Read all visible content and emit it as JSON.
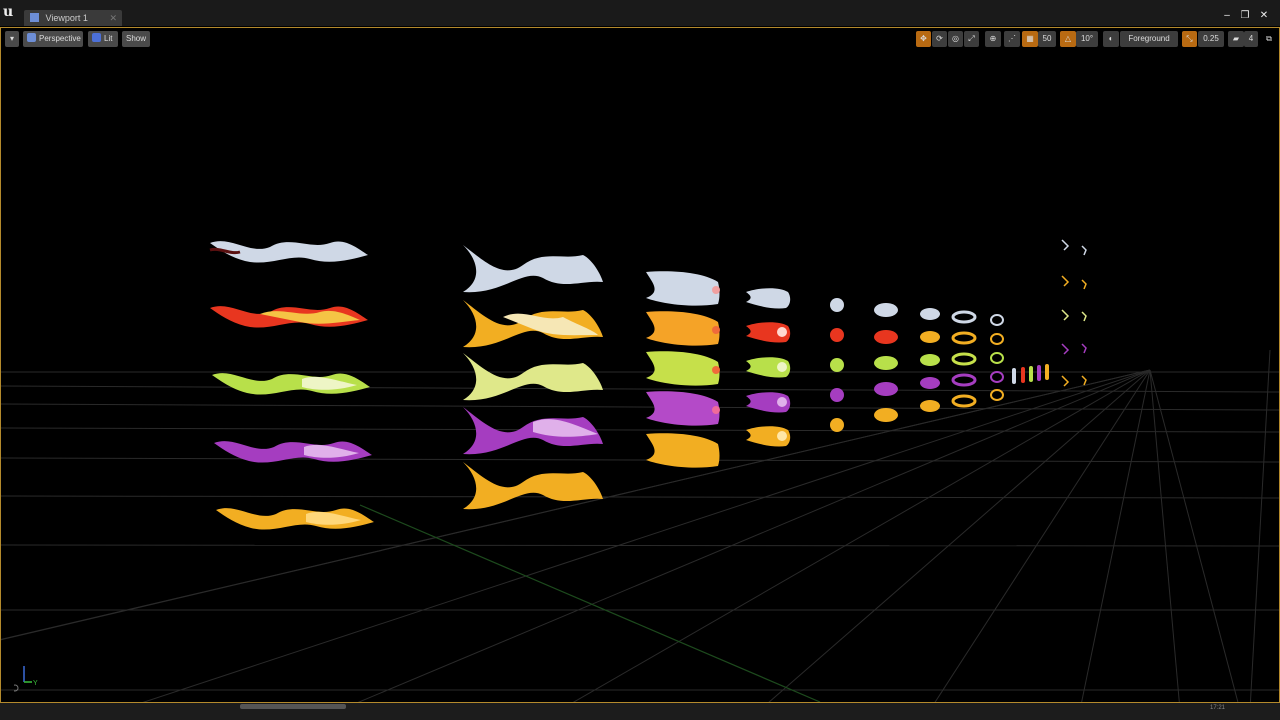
{
  "window": {
    "tab_title": "Viewport 1",
    "minimize_glyph": "–",
    "restore_glyph": "❐",
    "close_glyph": "✕"
  },
  "toolbar": {
    "menu_glyph": "▾",
    "perspective_label": "Perspective",
    "lit_label": "Lit",
    "show_label": "Show",
    "grid_snap_value": "50",
    "rotation_snap_value": "10°",
    "layer_label": "Foreground",
    "scale_snap_value": "0.25",
    "camera_speed_value": "4"
  },
  "statusbar": {
    "timestamp": "17:21"
  },
  "accent_colors": {
    "frame_border": "#b48a2c",
    "toolbar_orange": "#b86a12"
  },
  "effect_palette": [
    "#cfd8e6",
    "#e8361f",
    "#b8e04a",
    "#a53dc0",
    "#f2ae22"
  ],
  "icons": [
    "unreal-logo-icon",
    "viewport-tab-icon",
    "perspective-icon",
    "lit-icon",
    "translate-icon",
    "rotate-icon",
    "scale-icon",
    "world-icon",
    "surface-snap-icon",
    "grid-icon",
    "angle-icon",
    "layer-icon",
    "scale-snap-icon",
    "camera-speed-icon",
    "maximize-icon",
    "axis-gizmo-icon"
  ]
}
